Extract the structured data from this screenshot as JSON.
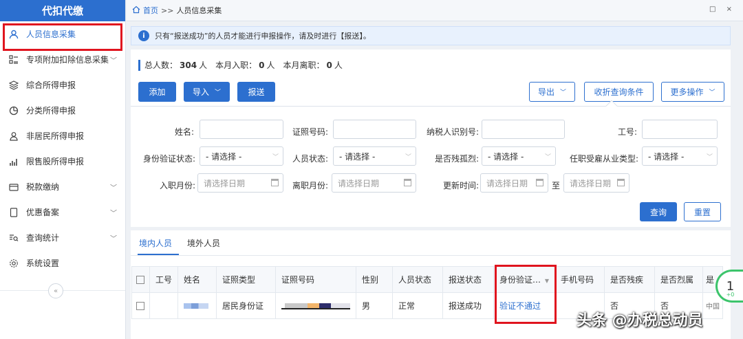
{
  "sidebar": {
    "title": "代扣代缴",
    "items": [
      {
        "label": "人员信息采集",
        "icon": "person-icon",
        "active": true,
        "chevron": false
      },
      {
        "label": "专项附加扣除信息采集",
        "icon": "list-icon",
        "chevron": true
      },
      {
        "label": "综合所得申报",
        "icon": "layers-icon",
        "chevron": false
      },
      {
        "label": "分类所得申报",
        "icon": "pie-icon",
        "chevron": false
      },
      {
        "label": "非居民所得申报",
        "icon": "user-outline-icon",
        "chevron": false
      },
      {
        "label": "限售股所得申报",
        "icon": "bar-chart-icon",
        "chevron": false
      },
      {
        "label": "税款缴纳",
        "icon": "wallet-icon",
        "chevron": true
      },
      {
        "label": "优惠备案",
        "icon": "document-icon",
        "chevron": true
      },
      {
        "label": "查询统计",
        "icon": "search-list-icon",
        "chevron": true
      },
      {
        "label": "系统设置",
        "icon": "gear-icon",
        "chevron": false
      }
    ],
    "collapse_glyph": "«"
  },
  "breadcrumb": {
    "home": "首页",
    "sep": ">>",
    "current": "人员信息采集",
    "win_controls": "□ ×"
  },
  "notice": {
    "icon": "i",
    "text": "只有“报送成功”的人员才能进行申报操作，请及时进行【报送】。"
  },
  "stats": {
    "total_label": "总人数：",
    "total_value": "304",
    "total_unit": "人",
    "month_in_label": "本月入职：",
    "month_in_value": "0",
    "month_in_unit": "人",
    "month_out_label": "本月离职：",
    "month_out_value": "0",
    "month_out_unit": "人"
  },
  "toolbar": {
    "add": "添加",
    "import": "导入",
    "submit": "报送",
    "export": "导出",
    "collapse_query": "收折查询条件",
    "more": "更多操作"
  },
  "filters": {
    "name_label": "姓名:",
    "id_no_label": "证照号码:",
    "taxpayer_id_label": "纳税人识别号:",
    "work_no_label": "工号:",
    "id_verify_label": "身份验证状态:",
    "id_verify_value": "- 请选择 -",
    "person_status_label": "人员状态:",
    "person_status_value": "- 请选择 -",
    "disabled_label": "是否残孤烈:",
    "disabled_value": "- 请选择 -",
    "employ_type_label": "任职受雇从业类型:",
    "employ_type_value": "- 请选择 -",
    "join_month_label": "入职月份:",
    "join_month_placeholder": "请选择日期",
    "leave_month_label": "离职月份:",
    "leave_month_placeholder": "请选择日期",
    "update_time_label": "更新时间:",
    "update_from_placeholder": "请选择日期",
    "to_label": "至",
    "update_to_placeholder": "请选择日期",
    "query_button": "查询",
    "reset_button": "重置"
  },
  "tabs": {
    "domestic": "境内人员",
    "foreign": "境外人员"
  },
  "table": {
    "headers": [
      "工号",
      "姓名",
      "证照类型",
      "证照号码",
      "性别",
      "人员状态",
      "报送状态",
      "身份验证…",
      "手机号码",
      "是否残疾",
      "是否烈属",
      "是"
    ],
    "rows": [
      {
        "work_no": "",
        "id_type": "居民身份证",
        "gender": "男",
        "person_status": "正常",
        "submit_status": "报送成功",
        "verify_status": "验证不通过",
        "phone": "",
        "disabled": "否",
        "martyr": "否",
        "lone": "中国"
      }
    ]
  },
  "watermark": "头条 @办税总动员",
  "bubble": {
    "value": "1",
    "small": "+0"
  }
}
